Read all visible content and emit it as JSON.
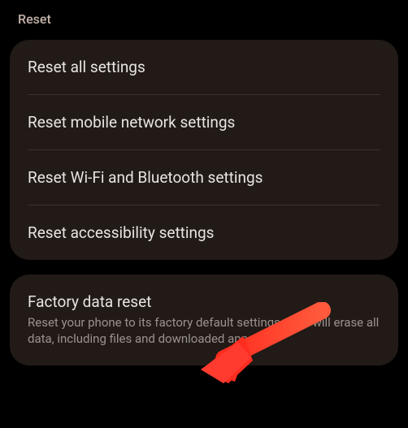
{
  "header": {
    "title": "Reset"
  },
  "group1": {
    "items": [
      {
        "title": "Reset all settings"
      },
      {
        "title": "Reset mobile network settings"
      },
      {
        "title": "Reset Wi-Fi and Bluetooth settings"
      },
      {
        "title": "Reset accessibility settings"
      }
    ]
  },
  "group2": {
    "items": [
      {
        "title": "Factory data reset",
        "subtitle": "Reset your phone to its factory default settings. This will erase all data, including files and downloaded apps."
      }
    ]
  },
  "annotation": {
    "arrow_color": "#ff3b30"
  }
}
